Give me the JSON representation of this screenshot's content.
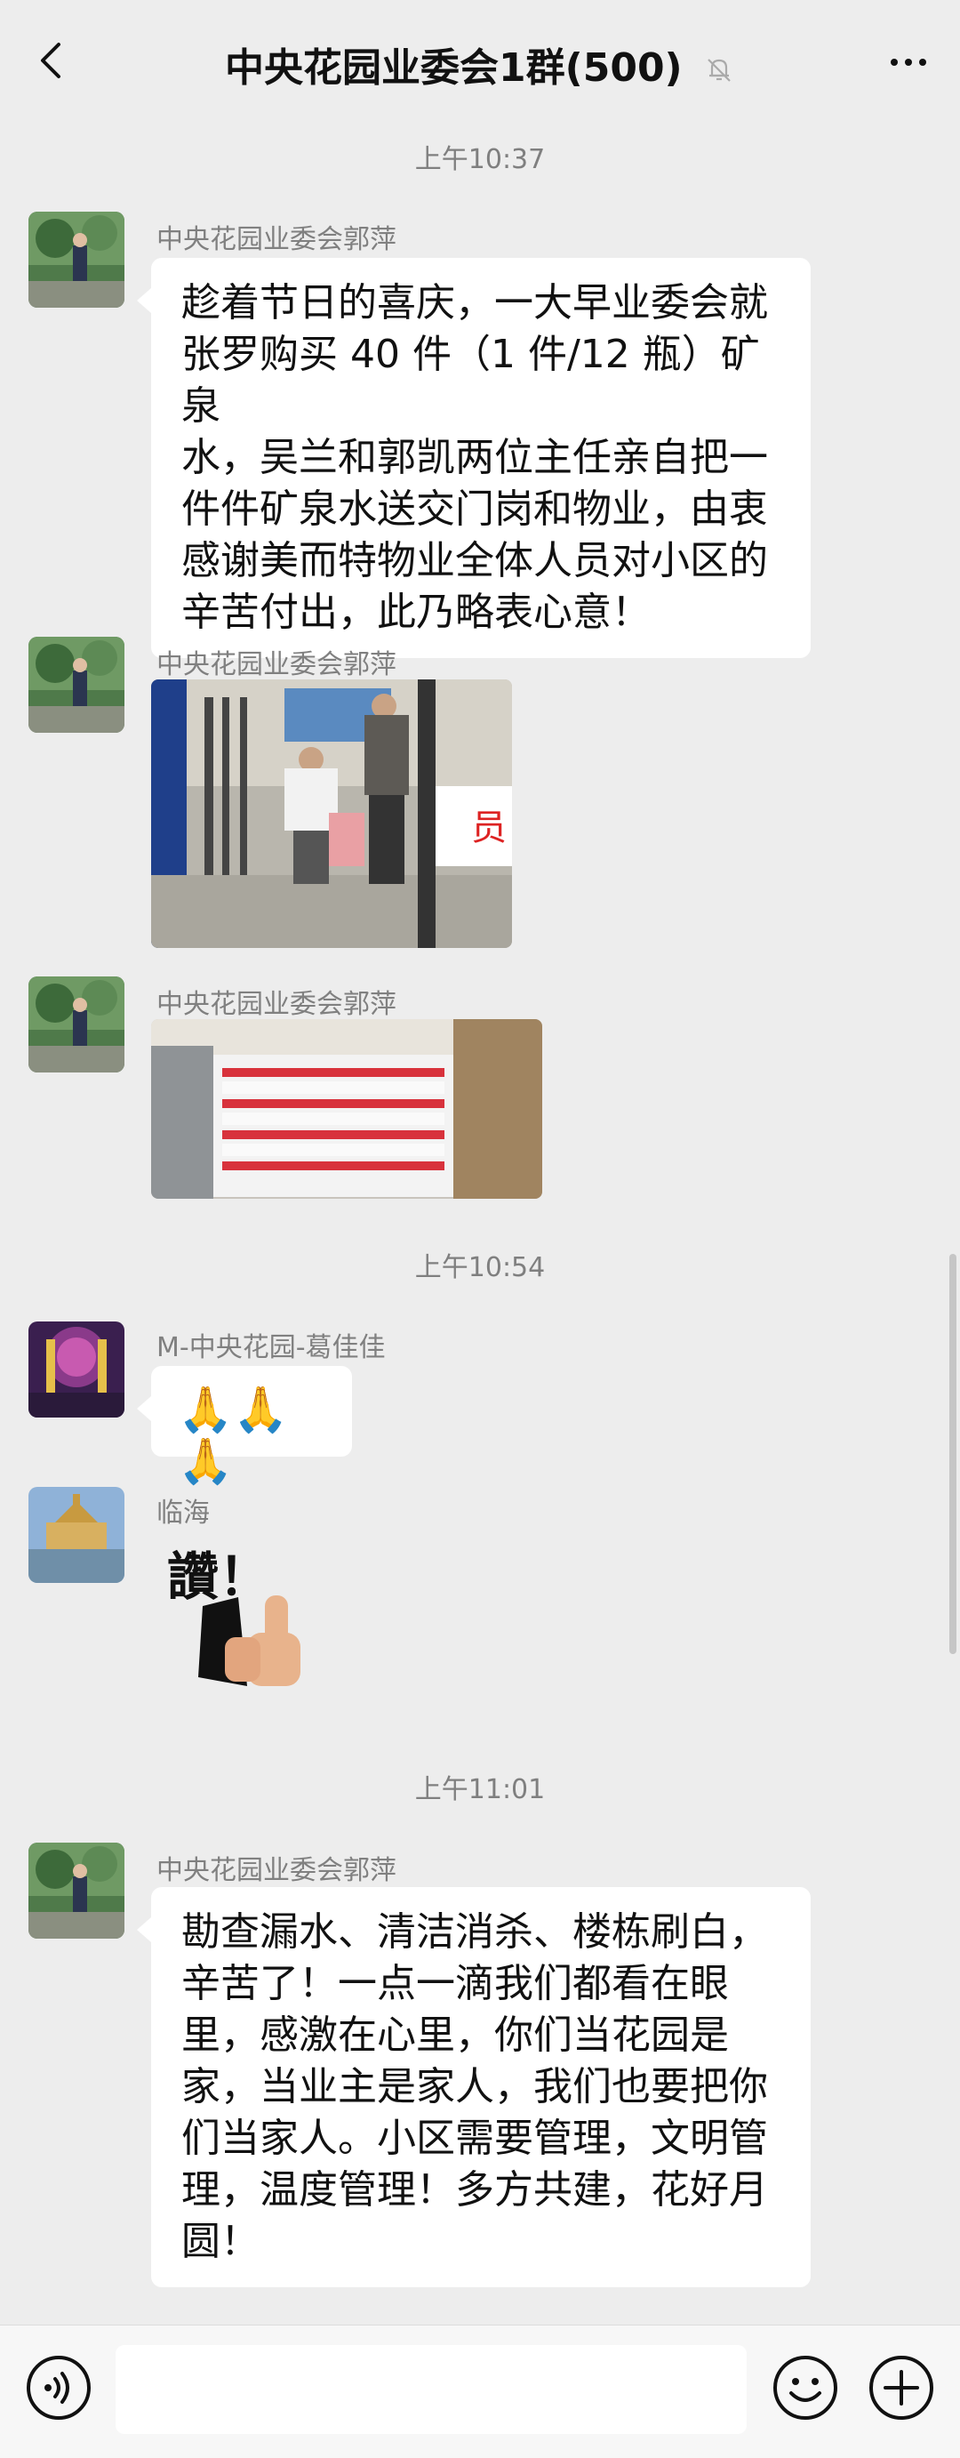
{
  "header": {
    "title": "中央花园业委会1群(500)"
  },
  "timestamps": [
    "上午10:37",
    "上午10:54",
    "上午11:01"
  ],
  "messages": [
    {
      "sender": "中央花园业委会郭萍",
      "text_lines": [
        "趁着节日的喜庆，一大早业委会就",
        "张罗购买 40 件（1 件/12 瓶）矿泉",
        "水，吴兰和郭凯两位主任亲自把一",
        "件件矿泉水送交门岗和物业，由衷",
        "感谢美而特物业全体人员对小区的",
        "辛苦付出，此乃略表心意！"
      ]
    },
    {
      "sender": "中央花园业委会郭萍",
      "photo_sign": "员",
      "photo_description": "volunteer handing water to security guard"
    },
    {
      "sender": "中央花园业委会郭萍",
      "photo_description": "stack of bottled water cases"
    },
    {
      "sender": "M-中央花园-葛佳佳",
      "emoji": "🙏🙏🙏"
    },
    {
      "sender": "临海",
      "sticker_text": "讚！"
    },
    {
      "sender": "中央花园业委会郭萍",
      "text_lines": [
        "勘查漏水、清洁消杀、楼栋刷白，",
        "辛苦了！一点一滴我们都看在眼",
        "里，感激在心里，你们当花园是",
        "家，当业主是家人，我们也要把你",
        "们当家人。小区需要管理，文明管",
        "理，温度管理！多方共建，花好月",
        "圆！"
      ]
    }
  ],
  "icons": {
    "back": "back-arrow-icon",
    "mute": "muted-bell-icon",
    "more": "more-dots-icon",
    "voice": "voice-icon",
    "emoji": "emoji-icon",
    "plus": "plus-icon"
  },
  "colors": {
    "background": "#ededed",
    "bubble": "#ffffff",
    "meta_text": "#808080"
  }
}
